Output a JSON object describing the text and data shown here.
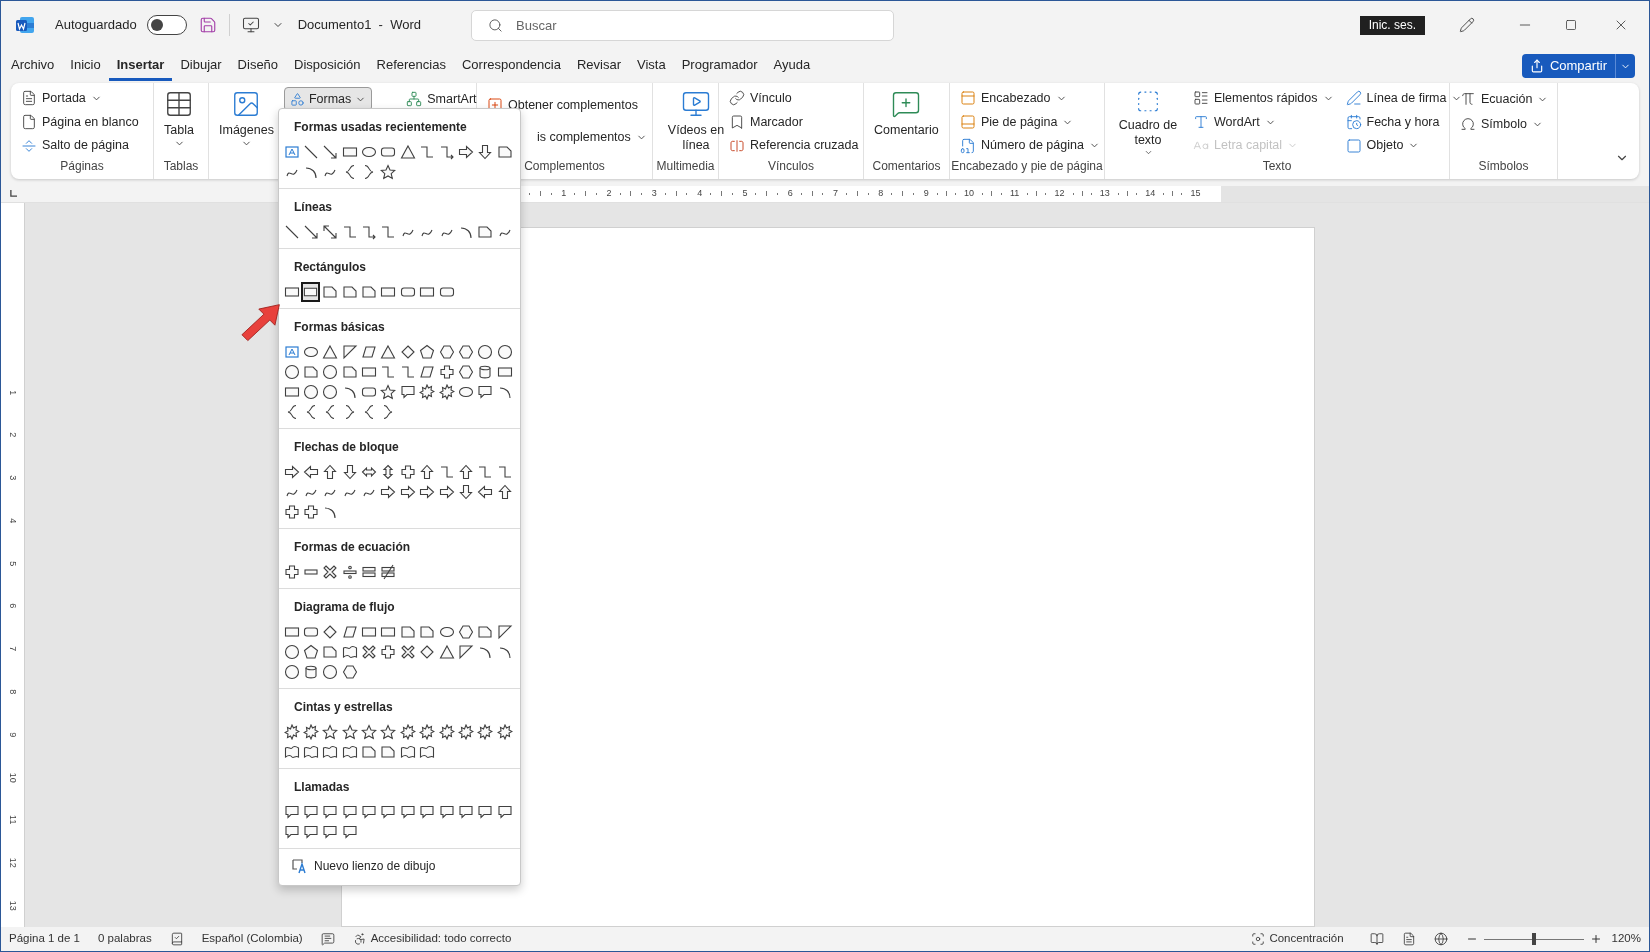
{
  "title_bar": {
    "autosave_label": "Autoguardado",
    "autosave_on": false,
    "document_title": "Documento1  -  Word",
    "search_placeholder": "Buscar",
    "sign_in": "Inic. ses."
  },
  "tabs": [
    {
      "label": "Archivo",
      "selected": false
    },
    {
      "label": "Inicio",
      "selected": false
    },
    {
      "label": "Insertar",
      "selected": true
    },
    {
      "label": "Dibujar",
      "selected": false
    },
    {
      "label": "Diseño",
      "selected": false
    },
    {
      "label": "Disposición",
      "selected": false
    },
    {
      "label": "Referencias",
      "selected": false
    },
    {
      "label": "Correspondencia",
      "selected": false
    },
    {
      "label": "Revisar",
      "selected": false
    },
    {
      "label": "Vista",
      "selected": false
    },
    {
      "label": "Programador",
      "selected": false
    },
    {
      "label": "Ayuda",
      "selected": false
    }
  ],
  "share_button": "Compartir",
  "ribbon": {
    "groups": [
      {
        "label": "Páginas",
        "items": [
          {
            "label": "Portada",
            "menu": true
          },
          {
            "label": "Página en blanco",
            "menu": false
          },
          {
            "label": "Salto de página",
            "menu": false
          }
        ]
      },
      {
        "label": "Tablas",
        "items": [
          {
            "label": "Tabla",
            "menu": true
          }
        ]
      },
      {
        "items": [
          {
            "label": "Imágenes",
            "menu": true
          },
          {
            "label": "Formas",
            "menu": true,
            "selected": true
          },
          {
            "label": "SmartArt",
            "menu": false
          }
        ]
      },
      {
        "label": "Complementos",
        "items": [
          {
            "label": "Obtener complementos",
            "menu": false
          },
          {
            "label": "is complementos",
            "menu": true
          }
        ]
      },
      {
        "label": "Multimedia",
        "items": [
          {
            "label": "Vídeos en línea",
            "menu": false
          }
        ]
      },
      {
        "label": "Vínculos",
        "items": [
          {
            "label": "Vínculo",
            "menu": false
          },
          {
            "label": "Marcador",
            "menu": false
          },
          {
            "label": "Referencia cruzada",
            "menu": false
          }
        ]
      },
      {
        "label": "Comentarios",
        "items": [
          {
            "label": "Comentario",
            "menu": false
          }
        ]
      },
      {
        "label": "Encabezado y pie de página",
        "items": [
          {
            "label": "Encabezado",
            "menu": true
          },
          {
            "label": "Pie de página",
            "menu": true
          },
          {
            "label": "Número de página",
            "menu": true
          }
        ]
      },
      {
        "label": "Texto",
        "items": [
          {
            "label": "Cuadro de texto",
            "menu": true,
            "disabled": false
          },
          {
            "label": "Elementos rápidos",
            "menu": true,
            "disabled": false
          },
          {
            "label": "WordArt",
            "menu": true,
            "disabled": false
          },
          {
            "label": "Letra capital",
            "menu": true,
            "disabled": true
          },
          {
            "label": "Línea de firma",
            "menu": true,
            "disabled": false
          },
          {
            "label": "Fecha y hora",
            "menu": false,
            "disabled": false
          },
          {
            "label": "Objeto",
            "menu": true,
            "disabled": false
          }
        ]
      },
      {
        "label": "Símbolos",
        "items": [
          {
            "label": "Ecuación",
            "menu": true
          },
          {
            "label": "Símbolo",
            "menu": true
          }
        ]
      }
    ]
  },
  "shapes_menu": {
    "sections": [
      {
        "title": "Formas usadas recientemente",
        "shapes": [
          {
            "selected": false
          },
          {
            "selected": false
          },
          {
            "selected": false
          },
          {
            "selected": false
          },
          {
            "selected": false
          },
          {
            "selected": false
          },
          {
            "selected": false
          },
          {
            "selected": false
          },
          {
            "selected": false
          },
          {
            "selected": false
          },
          {
            "selected": false
          },
          {
            "selected": false
          },
          {
            "selected": false
          },
          {
            "selected": false
          },
          {
            "selected": false
          },
          {
            "selected": false
          },
          {
            "selected": false
          },
          {
            "selected": false
          }
        ]
      },
      {
        "title": "Líneas",
        "shapes": [
          {
            "selected": false
          },
          {
            "selected": false
          },
          {
            "selected": false
          },
          {
            "selected": false
          },
          {
            "selected": false
          },
          {
            "selected": false
          },
          {
            "selected": false
          },
          {
            "selected": false
          },
          {
            "selected": false
          },
          {
            "selected": false
          },
          {
            "selected": false
          },
          {
            "selected": false
          }
        ]
      },
      {
        "title": "Rectángulos",
        "shapes": [
          {
            "selected": false
          },
          {
            "selected": true
          },
          {
            "selected": false
          },
          {
            "selected": false
          },
          {
            "selected": false
          },
          {
            "selected": false
          },
          {
            "selected": false
          },
          {
            "selected": false
          },
          {
            "selected": false
          }
        ]
      },
      {
        "title": "Formas básicas",
        "shapes": [
          {
            "selected": false
          },
          {
            "selected": false
          },
          {
            "selected": false
          },
          {
            "selected": false
          },
          {
            "selected": false
          },
          {
            "selected": false
          },
          {
            "selected": false
          },
          {
            "selected": false
          },
          {
            "selected": false
          },
          {
            "selected": false
          },
          {
            "selected": false
          },
          {
            "selected": false
          },
          {
            "selected": false
          },
          {
            "selected": false
          },
          {
            "selected": false
          },
          {
            "selected": false
          },
          {
            "selected": false
          },
          {
            "selected": false
          },
          {
            "selected": false
          },
          {
            "selected": false
          },
          {
            "selected": false
          },
          {
            "selected": false
          },
          {
            "selected": false
          },
          {
            "selected": false
          },
          {
            "selected": false
          },
          {
            "selected": false
          },
          {
            "selected": false
          },
          {
            "selected": false
          },
          {
            "selected": false
          },
          {
            "selected": false
          },
          {
            "selected": false
          },
          {
            "selected": false
          },
          {
            "selected": false
          },
          {
            "selected": false
          },
          {
            "selected": false
          },
          {
            "selected": false
          },
          {
            "selected": false
          },
          {
            "selected": false
          },
          {
            "selected": false
          },
          {
            "selected": false
          },
          {
            "selected": false
          },
          {
            "selected": false
          }
        ]
      },
      {
        "title": "Flechas de bloque",
        "shapes": [
          {
            "selected": false
          },
          {
            "selected": false
          },
          {
            "selected": false
          },
          {
            "selected": false
          },
          {
            "selected": false
          },
          {
            "selected": false
          },
          {
            "selected": false
          },
          {
            "selected": false
          },
          {
            "selected": false
          },
          {
            "selected": false
          },
          {
            "selected": false
          },
          {
            "selected": false
          },
          {
            "selected": false
          },
          {
            "selected": false
          },
          {
            "selected": false
          },
          {
            "selected": false
          },
          {
            "selected": false
          },
          {
            "selected": false
          },
          {
            "selected": false
          },
          {
            "selected": false
          },
          {
            "selected": false
          },
          {
            "selected": false
          },
          {
            "selected": false
          },
          {
            "selected": false
          },
          {
            "selected": false
          },
          {
            "selected": false
          },
          {
            "selected": false
          }
        ]
      },
      {
        "title": "Formas de ecuación",
        "shapes": [
          {
            "selected": false
          },
          {
            "selected": false
          },
          {
            "selected": false
          },
          {
            "selected": false
          },
          {
            "selected": false
          },
          {
            "selected": false
          }
        ]
      },
      {
        "title": "Diagrama de flujo",
        "shapes": [
          {
            "selected": false
          },
          {
            "selected": false
          },
          {
            "selected": false
          },
          {
            "selected": false
          },
          {
            "selected": false
          },
          {
            "selected": false
          },
          {
            "selected": false
          },
          {
            "selected": false
          },
          {
            "selected": false
          },
          {
            "selected": false
          },
          {
            "selected": false
          },
          {
            "selected": false
          },
          {
            "selected": false
          },
          {
            "selected": false
          },
          {
            "selected": false
          },
          {
            "selected": false
          },
          {
            "selected": false
          },
          {
            "selected": false
          },
          {
            "selected": false
          },
          {
            "selected": false
          },
          {
            "selected": false
          },
          {
            "selected": false
          },
          {
            "selected": false
          },
          {
            "selected": false
          },
          {
            "selected": false
          },
          {
            "selected": false
          },
          {
            "selected": false
          },
          {
            "selected": false
          }
        ]
      },
      {
        "title": "Cintas y estrellas",
        "shapes": [
          {
            "selected": false
          },
          {
            "selected": false
          },
          {
            "selected": false
          },
          {
            "selected": false
          },
          {
            "selected": false
          },
          {
            "selected": false
          },
          {
            "selected": false
          },
          {
            "selected": false
          },
          {
            "selected": false
          },
          {
            "selected": false
          },
          {
            "selected": false
          },
          {
            "selected": false
          },
          {
            "selected": false
          },
          {
            "selected": false
          },
          {
            "selected": false
          },
          {
            "selected": false
          },
          {
            "selected": false
          },
          {
            "selected": false
          },
          {
            "selected": false
          },
          {
            "selected": false
          }
        ]
      },
      {
        "title": "Llamadas",
        "shapes": [
          {
            "selected": false
          },
          {
            "selected": false
          },
          {
            "selected": false
          },
          {
            "selected": false
          },
          {
            "selected": false
          },
          {
            "selected": false
          },
          {
            "selected": false
          },
          {
            "selected": false
          },
          {
            "selected": false
          },
          {
            "selected": false
          },
          {
            "selected": false
          },
          {
            "selected": false
          },
          {
            "selected": false
          },
          {
            "selected": false
          },
          {
            "selected": false
          },
          {
            "selected": false
          }
        ]
      }
    ],
    "footer_item": "Nuevo lienzo de dibujo"
  },
  "ruler": {
    "horizontal_numbers": [
      "1",
      "2",
      "3",
      "4",
      "5",
      "6",
      "7",
      "8",
      "9",
      "10",
      "11",
      "12",
      "13",
      "14",
      "15"
    ],
    "vertical_numbers": [
      "1",
      "2",
      "3",
      "4",
      "5",
      "6",
      "7",
      "8",
      "9",
      "10",
      "11",
      "12",
      "13"
    ]
  },
  "status_bar": {
    "page": "Página 1 de 1",
    "words": "0 palabras",
    "language": "Español (Colombia)",
    "accessibility": "Accesibilidad: todo correcto",
    "focus": "Concentración",
    "zoom": {
      "level": 0.5,
      "reading": "120%"
    }
  }
}
